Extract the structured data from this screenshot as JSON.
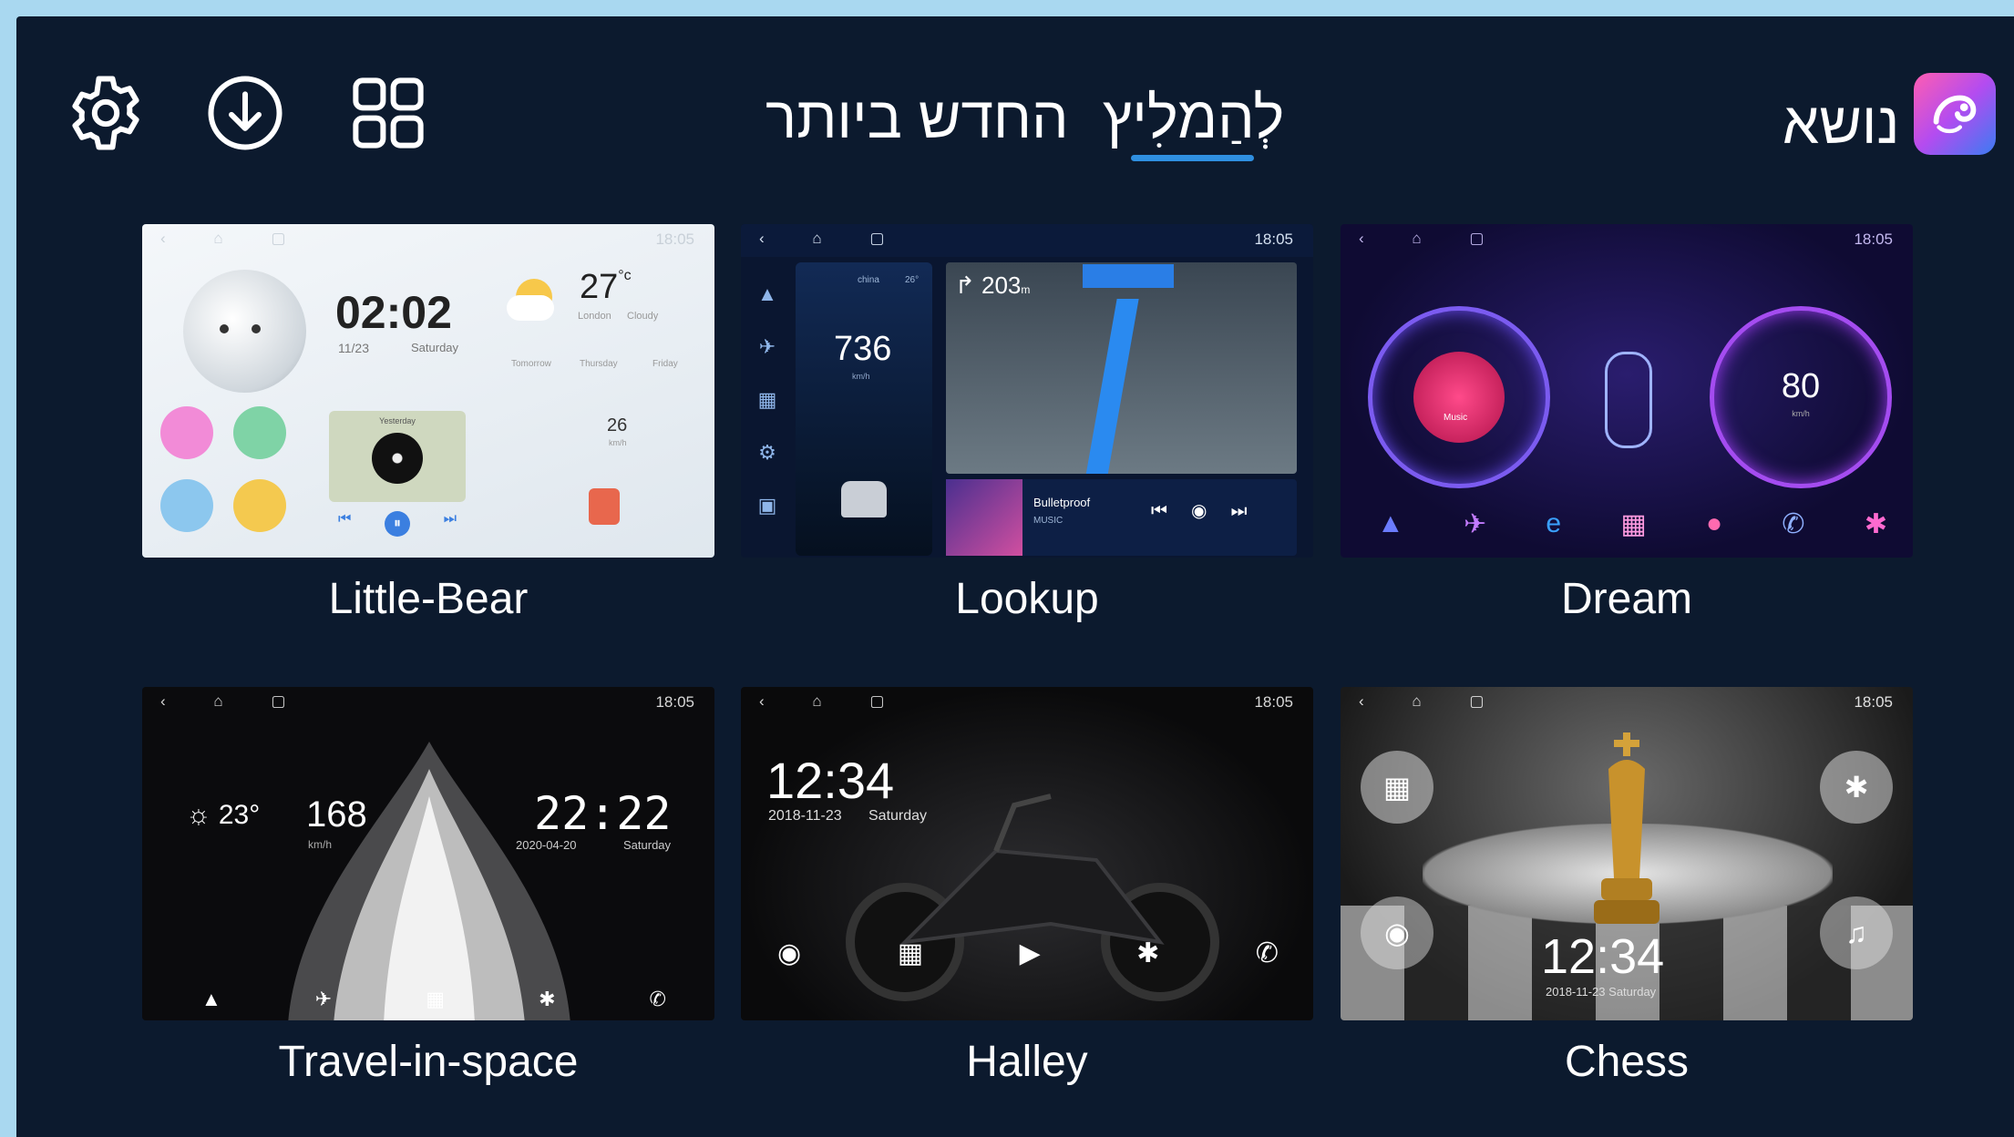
{
  "header": {
    "icons": [
      "gear-icon",
      "download-icon",
      "grid-icon"
    ],
    "tabs": [
      {
        "label": "לְהַמלִיץ",
        "active": true
      },
      {
        "label": "החדש ביותר",
        "active": false
      }
    ],
    "title": "נושא",
    "accent": "#2f8fe0"
  },
  "themes": [
    {
      "name": "Little-Bear",
      "preview": {
        "time": "02:02",
        "date": "11/23",
        "day": "Saturday",
        "temp": "27",
        "temp_unit": "°c",
        "city": "London",
        "weather": "Cloudy",
        "forecast": [
          "Tomorrow",
          "Thursday",
          "Friday"
        ],
        "speed": "26",
        "speed_unit": "km/h",
        "status_time": "18:05",
        "music": "Yesterday"
      }
    },
    {
      "name": "Lookup",
      "preview": {
        "status_time": "18:05",
        "speed": "736",
        "speed_unit": "km/h",
        "distance": "203",
        "distance_unit": "m",
        "weather_city": "china",
        "weather_temp": "26°",
        "song": "Bulletproof",
        "song_sub": "MUSIC"
      }
    },
    {
      "name": "Dream",
      "preview": {
        "status_time": "18:05",
        "speed": "80",
        "speed_unit": "km/h",
        "music_label": "Music"
      }
    },
    {
      "name": "Travel-in-space",
      "preview": {
        "status_time": "18:05",
        "temp": "23°",
        "speed": "168",
        "speed_unit": "km/h",
        "time": "22:22",
        "date": "2020-04-20",
        "day": "Saturday"
      }
    },
    {
      "name": "Halley",
      "preview": {
        "status_time": "18:05",
        "time": "12:34",
        "date": "2018-11-23",
        "day": "Saturday"
      }
    },
    {
      "name": "Chess",
      "preview": {
        "status_time": "18:05",
        "time": "12:34",
        "date": "2018-11-23 Saturday"
      }
    }
  ]
}
